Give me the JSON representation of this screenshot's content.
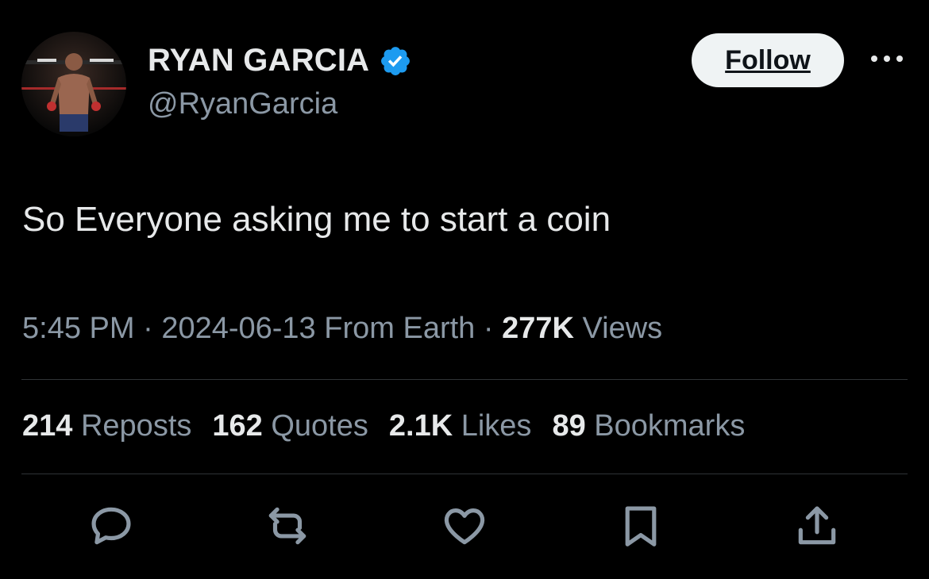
{
  "author": {
    "display_name": "RYAN GARCIA",
    "handle": "@RyanGarcia",
    "verified": true,
    "verified_icon": "verified-badge-icon",
    "avatar_icon": "profile-photo"
  },
  "follow_button": {
    "label": "Follow"
  },
  "more_icon": "more-options-icon",
  "tweet": {
    "text": "So Everyone asking me to start a coin"
  },
  "meta": {
    "time": "5:45 PM",
    "separator": "·",
    "date": "2024-06-13",
    "source": "From Earth",
    "views_count": "277K",
    "views_label": "Views"
  },
  "stats": [
    {
      "count": "214",
      "label": "Reposts"
    },
    {
      "count": "162",
      "label": "Quotes"
    },
    {
      "count": "2.1K",
      "label": "Likes"
    },
    {
      "count": "89",
      "label": "Bookmarks"
    }
  ],
  "actions": [
    "reply-icon",
    "repost-icon",
    "like-icon",
    "bookmark-icon",
    "share-icon"
  ],
  "colors": {
    "background": "#000000",
    "primary_text": "#e7e9ea",
    "secondary_text": "#8b98a5",
    "verified_blue": "#1d9bf0",
    "follow_bg": "#eff3f4",
    "divider": "#2f3336"
  }
}
